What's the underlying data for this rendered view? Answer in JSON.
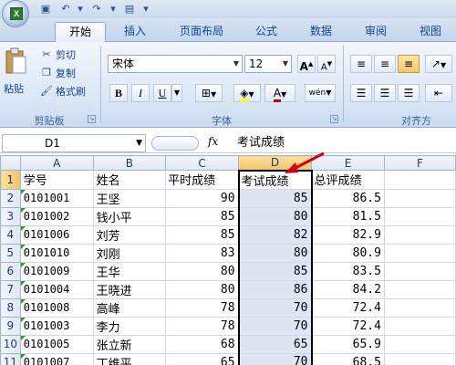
{
  "ribbon": {
    "tabs": [
      "开始",
      "插入",
      "页面布局",
      "公式",
      "数据",
      "审阅",
      "视图"
    ],
    "active_tab": "开始",
    "clipboard": {
      "paste_label": "粘贴",
      "cut_label": "剪切",
      "copy_label": "复制",
      "format_painter_label": "格式刷",
      "group_label": "剪贴板"
    },
    "font": {
      "font_name": "宋体",
      "font_size": "12",
      "grow_label": "A",
      "shrink_label": "A",
      "bold_label": "B",
      "italic_label": "I",
      "underline_label": "U",
      "font_color_label": "A",
      "phonetic_label": "wén",
      "group_label": "字体"
    },
    "alignment": {
      "group_label": "对齐方"
    }
  },
  "formula_bar": {
    "name_box": "D1",
    "fx_label": "fx",
    "content": "考试成绩"
  },
  "sheet": {
    "columns": [
      "A",
      "B",
      "C",
      "D",
      "E",
      "F"
    ],
    "selected_column": "D",
    "header_row": [
      "学号",
      "姓名",
      "平时成绩",
      "考试成绩",
      "总评成绩",
      ""
    ],
    "rows": [
      {
        "num": "1",
        "cells": [
          "学号",
          "姓名",
          "平时成绩",
          "考试成绩",
          "总评成绩",
          ""
        ]
      },
      {
        "num": "2",
        "cells": [
          "0101001",
          "王坚",
          "90",
          "85",
          "86.5",
          ""
        ]
      },
      {
        "num": "3",
        "cells": [
          "0101002",
          "钱小平",
          "85",
          "80",
          "81.5",
          ""
        ]
      },
      {
        "num": "4",
        "cells": [
          "0101006",
          "刘芳",
          "85",
          "82",
          "82.9",
          ""
        ]
      },
      {
        "num": "5",
        "cells": [
          "0101010",
          "刘刚",
          "83",
          "80",
          "80.9",
          ""
        ]
      },
      {
        "num": "6",
        "cells": [
          "0101009",
          "王华",
          "80",
          "85",
          "83.5",
          ""
        ]
      },
      {
        "num": "7",
        "cells": [
          "0101004",
          "王晓进",
          "80",
          "86",
          "84.2",
          ""
        ]
      },
      {
        "num": "8",
        "cells": [
          "0101008",
          "高峰",
          "78",
          "70",
          "72.4",
          ""
        ]
      },
      {
        "num": "9",
        "cells": [
          "0101003",
          "李力",
          "78",
          "70",
          "72.4",
          ""
        ]
      },
      {
        "num": "10",
        "cells": [
          "0101005",
          "张立新",
          "68",
          "65",
          "65.9",
          ""
        ]
      },
      {
        "num": "11",
        "cells": [
          "0101007",
          "丁维平",
          "65",
          "70",
          "68.5",
          ""
        ]
      }
    ]
  },
  "colors": {
    "selection_fill": "#dfe6f3",
    "selected_header": "#f5c36a",
    "annotation_arrow": "#d00000"
  }
}
